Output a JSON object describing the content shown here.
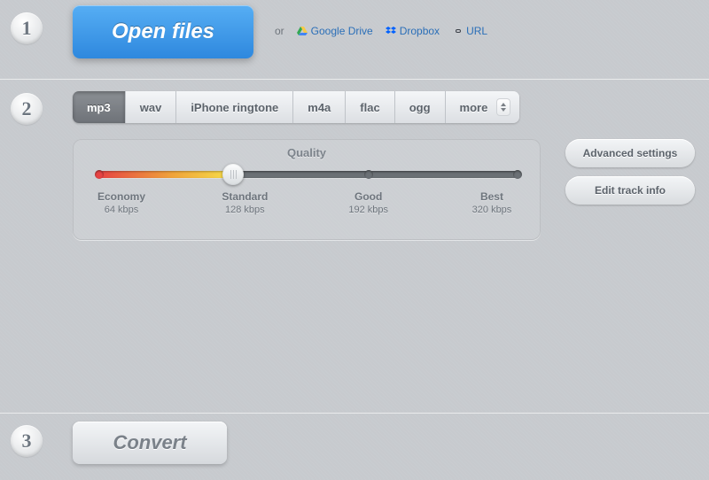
{
  "step1": {
    "num": "1",
    "open_label": "Open files",
    "or": "or",
    "gdrive": "Google Drive",
    "dropbox": "Dropbox",
    "url": "URL"
  },
  "step2": {
    "num": "2",
    "tabs": {
      "mp3": "mp3",
      "wav": "wav",
      "iphone": "iPhone ringtone",
      "m4a": "m4a",
      "flac": "flac",
      "ogg": "ogg",
      "more": "more"
    },
    "quality": {
      "title": "Quality",
      "points": [
        {
          "name": "Economy",
          "rate": "64 kbps"
        },
        {
          "name": "Standard",
          "rate": "128 kbps"
        },
        {
          "name": "Good",
          "rate": "192 kbps"
        },
        {
          "name": "Best",
          "rate": "320 kbps"
        }
      ]
    },
    "advanced": "Advanced settings",
    "edit_track": "Edit track info"
  },
  "step3": {
    "num": "3",
    "convert_label": "Convert"
  }
}
